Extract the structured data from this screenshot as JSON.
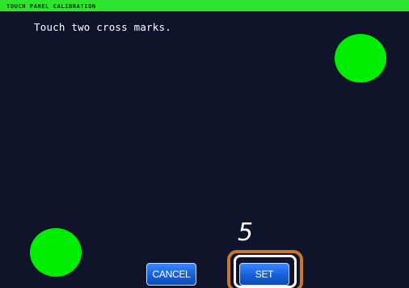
{
  "title": "TOUCH PANEL CALIBRATION",
  "instruction": "Touch two cross marks.",
  "buttons": {
    "cancel_label": "CANCEL",
    "set_label": "SET"
  },
  "callout": {
    "step_number": "5"
  },
  "colors": {
    "screen_background": "#0f142a",
    "title_bar": "#2fe42f",
    "calibration_mark": "#00ee00",
    "button": "#1460d8",
    "highlight": "#c8762a"
  },
  "icons": [
    "calibration-mark-top-right",
    "calibration-mark-bottom-left"
  ]
}
